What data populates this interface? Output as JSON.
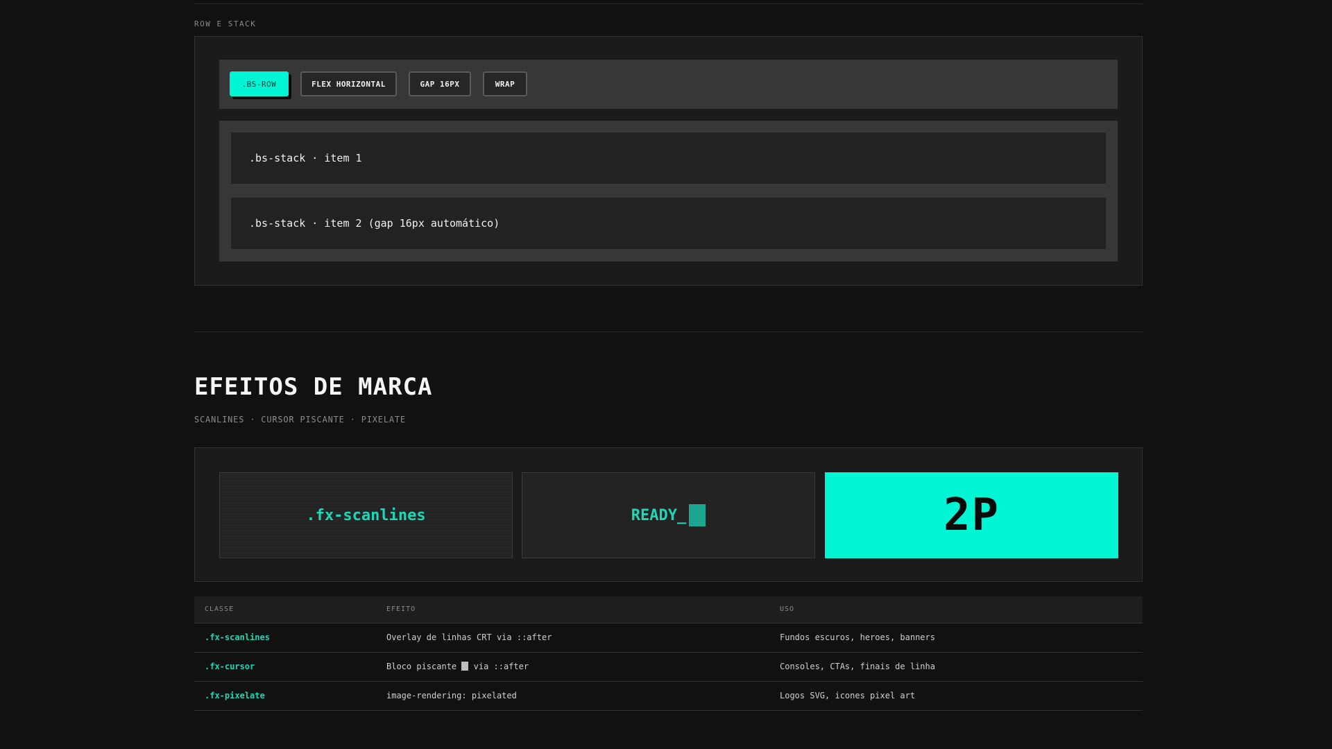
{
  "row_stack": {
    "section_label": "ROW E STACK",
    "pills": [
      {
        "label": ".BS-ROW",
        "active": true
      },
      {
        "label": "FLEX HORIZONTAL",
        "active": false
      },
      {
        "label": "GAP 16PX",
        "active": false
      },
      {
        "label": "WRAP",
        "active": false
      }
    ],
    "stack_items": [
      ".bs-stack · item 1",
      ".bs-stack · item 2 (gap 16px automático)"
    ]
  },
  "effects": {
    "title": "EFEITOS DE MARCA",
    "subtitle": "SCANLINES · CURSOR PISCANTE · PIXELATE",
    "cards": {
      "scanlines": ".fx-scanlines",
      "cursor": "READY_",
      "pixelate": "2P"
    },
    "accent_color": "#00f5d4"
  },
  "table": {
    "headers": [
      "CLASSE",
      "EFEITO",
      "USO"
    ],
    "rows": [
      {
        "classe": ".fx-scanlines",
        "efeito_before": "Overlay de linhas CRT via ::after",
        "efeito_after": "",
        "uso": "Fundos escuros, heroes, banners"
      },
      {
        "classe": ".fx-cursor",
        "efeito_before": "Bloco piscante",
        "efeito_after": "via ::after",
        "uso": "Consoles, CTAs, finais de linha"
      },
      {
        "classe": ".fx-pixelate",
        "efeito_before": "image-rendering: pixelated",
        "efeito_after": "",
        "uso": "Logos SVG, icones pixel art"
      }
    ]
  }
}
